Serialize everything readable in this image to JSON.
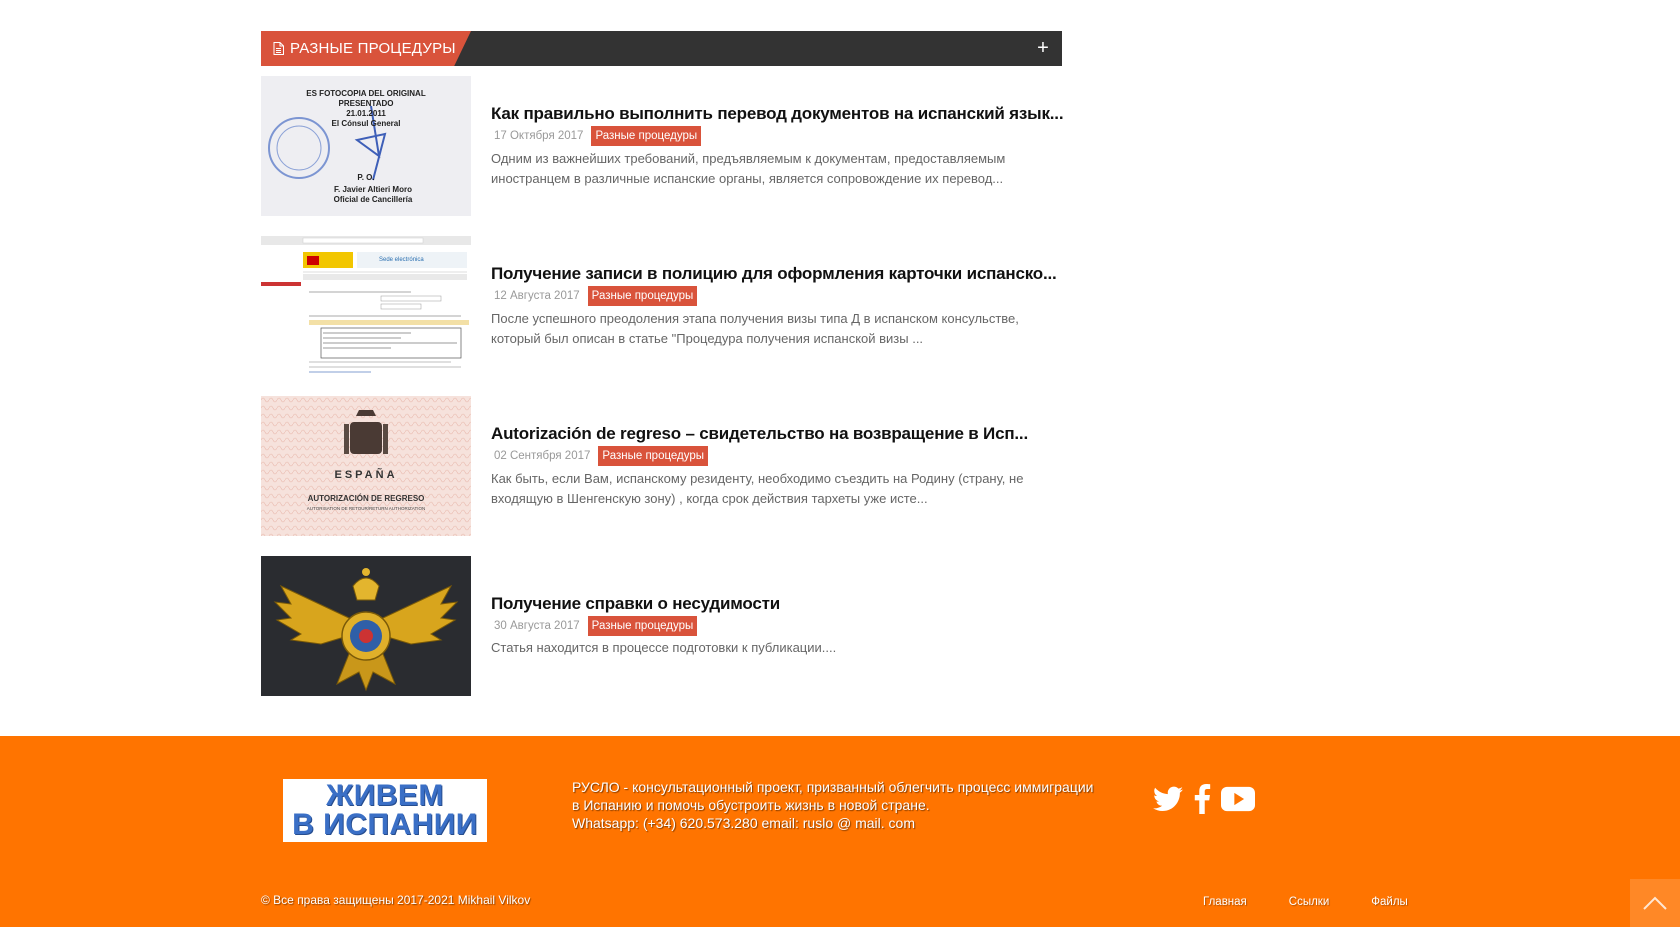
{
  "section": {
    "title": "Разные процедуры",
    "plus_symbol": "+"
  },
  "articles": [
    {
      "title": "Как правильно выполнить перевод документов на испанский язык...",
      "date": "17 Октября 2017",
      "category": "Разные процедуры",
      "excerpt": "Одним из важнейших требований, предъявляемым к документам, предоставляемым иностранцем в различные испанские органы, является сопровождение их перевод...",
      "thumb_lines": [
        "ES FOTOCOPIA DEL ORIGINAL",
        "PRESENTADO",
        "21.01.2011",
        "El Cónsul General",
        "P. O.",
        "F. Javier Altieri Moro",
        "Oficial de Cancillería"
      ]
    },
    {
      "title": "Получение записи в полицию для оформления карточки испанско...",
      "date": "12 Августа 2017",
      "category": "Разные процедуры",
      "excerpt": "После успешного преодоления этапа получения визы типа Д в испанском консульстве, который был описан в статье \"Процедура получения испанской визы ...",
      "thumb_lines": [
        "Sede electrónica"
      ]
    },
    {
      "title": "Autorización de regreso – свидетельство на возвращение в Исп...",
      "date": "02 Сентября 2017",
      "category": "Разные процедуры",
      "excerpt": "Как быть, если Вам, испанскому резиденту, необходимо съездить на Родину (страну, не входящую в Шенгенскую зону) , когда срок действия тархеты уже исте...",
      "thumb_lines": [
        "ESPAÑA",
        "AUTORIZACIÓN DE REGRESO",
        "AUTORISATION DE RETOUR/RETURN AUTHORIZATION"
      ]
    },
    {
      "title": "Получение справки о несудимости",
      "date": "30 Августа 2017",
      "category": "Разные процедуры",
      "excerpt": "Статья находится в процессе подготовки к публикации....",
      "thumb_lines": []
    }
  ],
  "footer": {
    "logo_line1": "ЖИВЕМ",
    "logo_line2": "В ИСПАНИИ",
    "description": "РУСЛО - консультационный проект, призванный облегчить процесс иммиграции в Испанию и помочь обустроить жизнь в новой стране.",
    "contacts": "Whatsapp: (+34) 620.573.280 email: ruslo @ mail. com",
    "copyright": "© Все права защищены 2017-2021 Mikhail Vilkov",
    "nav": [
      "Главная",
      "Ссылки",
      "Файлы"
    ],
    "social_icons": [
      "twitter-icon",
      "facebook-icon",
      "youtube-icon"
    ]
  },
  "colors": {
    "accent": "#d9533b",
    "header_dark": "#333333",
    "footer_bg": "#ff7400"
  }
}
